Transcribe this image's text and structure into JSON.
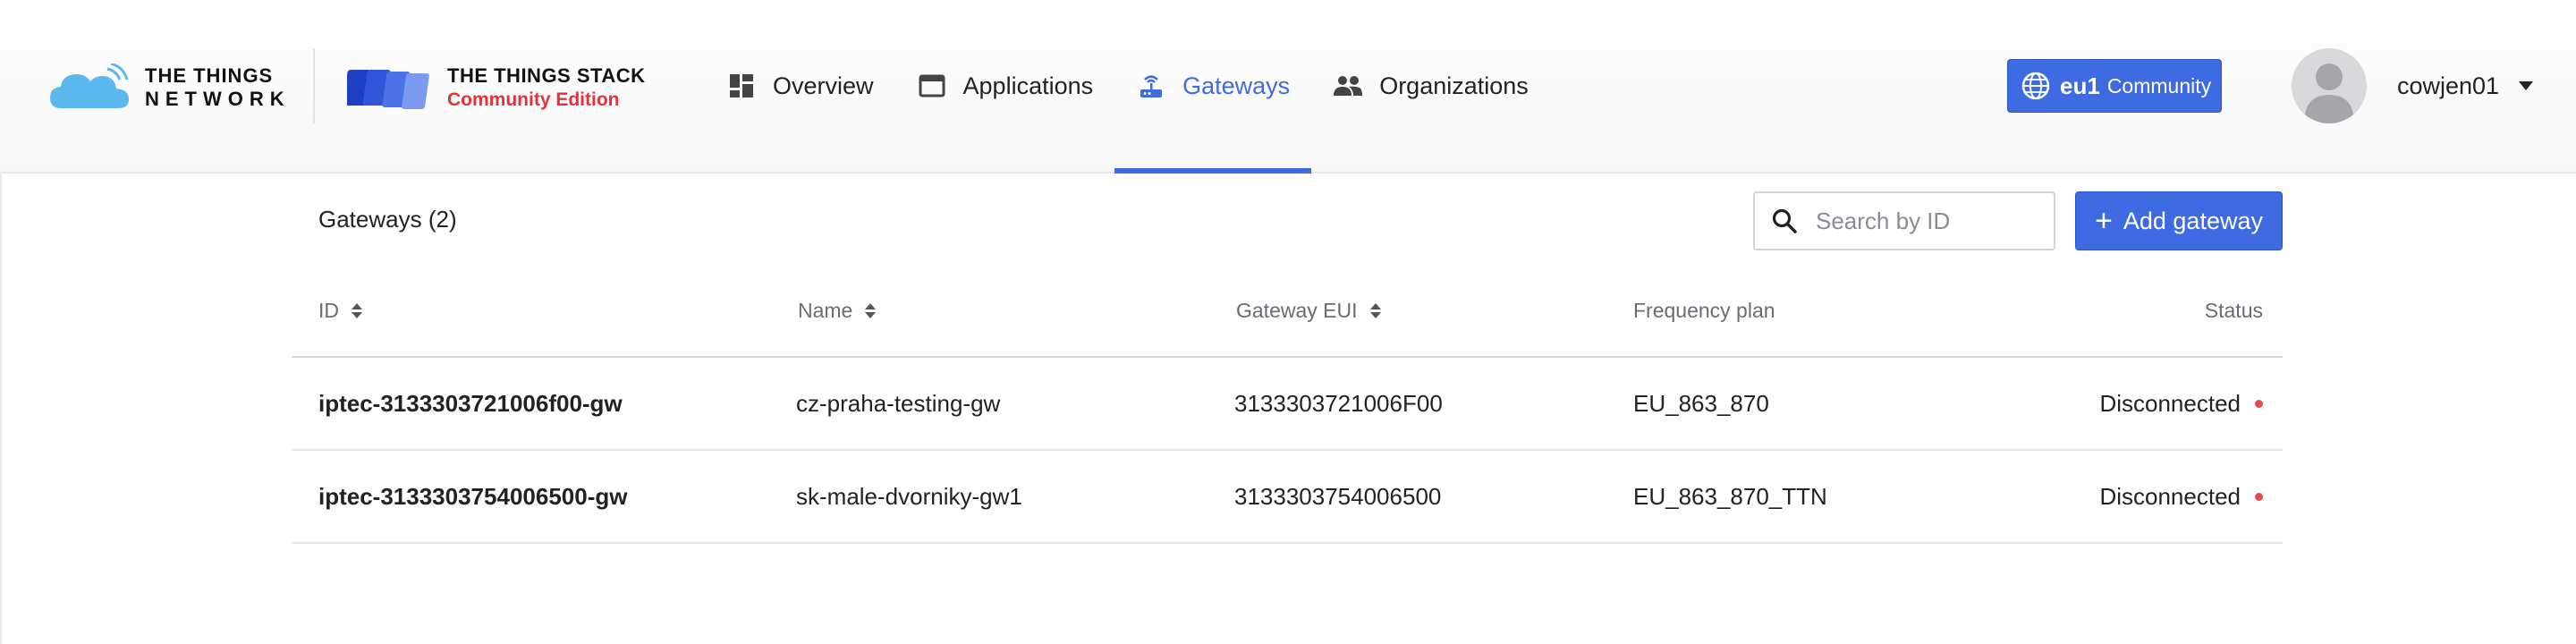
{
  "brand": {
    "ttn_line1": "THE THINGS",
    "ttn_line2": "NETWORK",
    "stack_title": "THE THINGS STACK",
    "stack_edition": "Community Edition",
    "accent": "#3e6ae2",
    "edition_color": "#e0343d"
  },
  "nav": {
    "items": [
      {
        "label": "Overview",
        "icon": "overview-icon"
      },
      {
        "label": "Applications",
        "icon": "applications-icon"
      },
      {
        "label": "Gateways",
        "icon": "gateway-icon",
        "active": true
      },
      {
        "label": "Organizations",
        "icon": "organizations-icon"
      }
    ]
  },
  "cluster": {
    "name": "eu1",
    "tier": "Community"
  },
  "user": {
    "name": "cowjen01"
  },
  "gateways": {
    "title": "Gateways (2)",
    "search_placeholder": "Search by ID",
    "add_label": "Add gateway",
    "columns": [
      "ID",
      "Name",
      "Gateway EUI",
      "Frequency plan",
      "Status"
    ],
    "rows": [
      {
        "id": "iptec-3133303721006f00-gw",
        "name": "cz-praha-testing-gw",
        "eui": "3133303721006F00",
        "plan": "EU_863_870",
        "status": "Disconnected"
      },
      {
        "id": "iptec-3133303754006500-gw",
        "name": "sk-male-dvorniky-gw1",
        "eui": "3133303754006500",
        "plan": "EU_863_870_TTN",
        "status": "Disconnected"
      }
    ],
    "status_color": "#e34b4b"
  }
}
